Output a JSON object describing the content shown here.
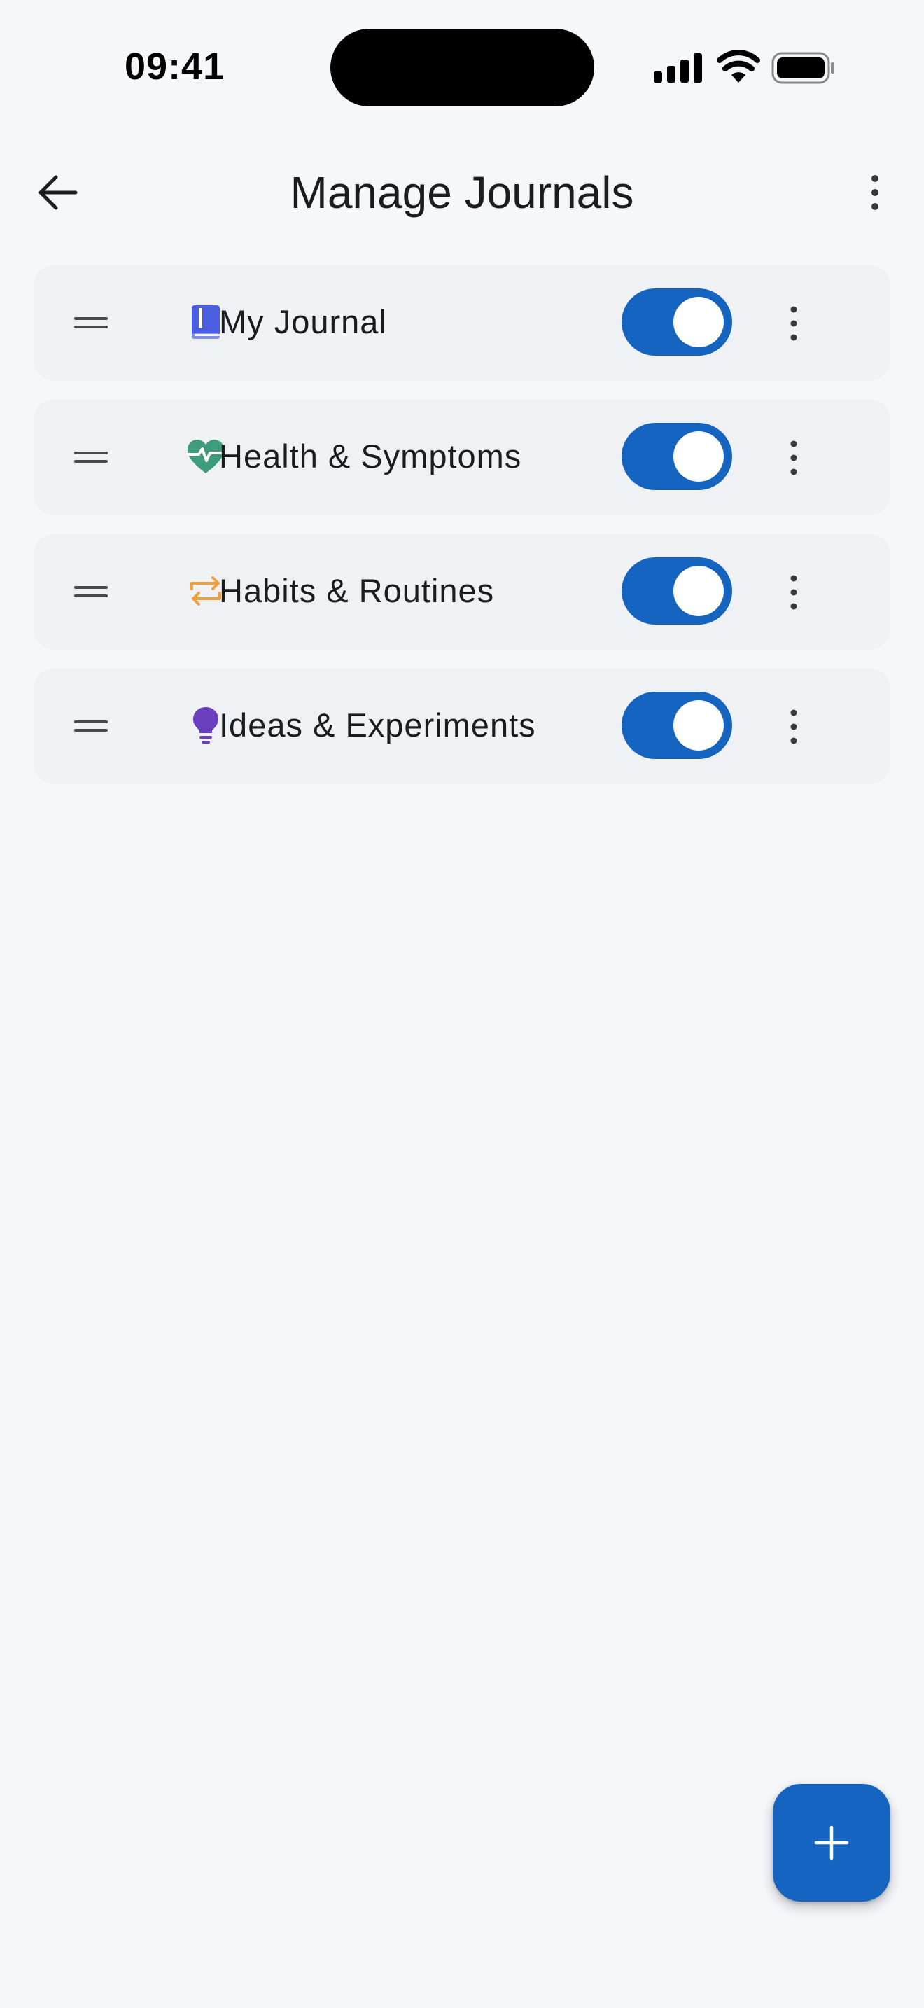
{
  "status_bar": {
    "time": "09:41",
    "icons": [
      "signal-icon",
      "wifi-icon",
      "battery-icon"
    ]
  },
  "app_bar": {
    "title": "Manage Journals",
    "back_icon": "arrow-left-icon",
    "menu_icon": "more-vertical-icon"
  },
  "journals": [
    {
      "name": "My Journal",
      "icon": "book-icon",
      "icon_color": "#4a5ee0",
      "enabled": true
    },
    {
      "name": "Health & Symptoms",
      "icon": "heart-pulse-icon",
      "icon_color": "#3e9b7c",
      "enabled": true
    },
    {
      "name": "Habits & Routines",
      "icon": "repeat-icon",
      "icon_color": "#f0a03a",
      "enabled": true
    },
    {
      "name": "Ideas & Experiments",
      "icon": "lightbulb-icon",
      "icon_color": "#6a3fbe",
      "enabled": true
    }
  ],
  "colors": {
    "accent": "#1565c0",
    "background": "#f6f7fb",
    "card": "#f0f1f5"
  },
  "fab": {
    "icon": "plus-icon"
  }
}
